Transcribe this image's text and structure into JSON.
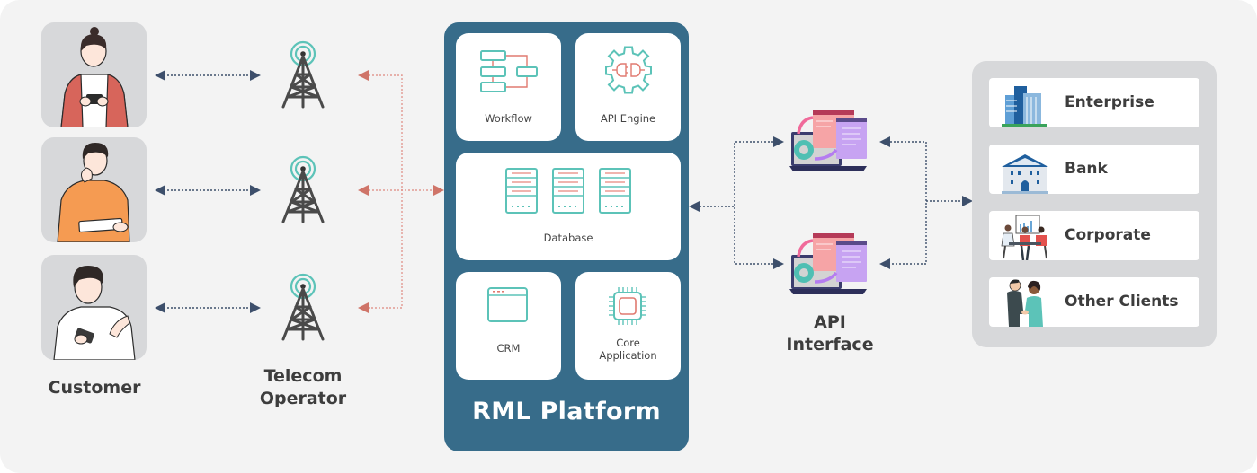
{
  "diagram": {
    "customer_section": {
      "label": "Customer",
      "items": [
        {
          "name": "customer-woman-phone",
          "description": "woman using phone"
        },
        {
          "name": "customer-man-tablet",
          "description": "man with tablet"
        },
        {
          "name": "customer-man-phone",
          "description": "man using phone"
        }
      ]
    },
    "telecom_section": {
      "label_line1": "Telecom",
      "label_line2": "Operator",
      "icon": "cell-tower-icon",
      "count": 3
    },
    "platform": {
      "title": "RML Platform",
      "modules": [
        {
          "id": "workflow",
          "label": "Workflow",
          "icon": "workflow-icon"
        },
        {
          "id": "api-engine",
          "label": "API Engine",
          "icon": "gear-plug-icon"
        },
        {
          "id": "database",
          "label": "Database",
          "icon": "server-icon"
        },
        {
          "id": "crm",
          "label": "CRM",
          "icon": "browser-window-icon"
        },
        {
          "id": "core-application",
          "label_line1": "Core",
          "label_line2": "Application",
          "icon": "chip-icon"
        }
      ]
    },
    "api_interface": {
      "label_line1": "API",
      "label_line2": "Interface",
      "icon": "api-laptop-icon",
      "count": 2
    },
    "clients": {
      "items": [
        {
          "label": "Enterprise",
          "icon": "office-building-icon"
        },
        {
          "label": "Bank",
          "icon": "bank-icon"
        },
        {
          "label": "Corporate",
          "icon": "meeting-icon"
        },
        {
          "label": "Other Clients",
          "icon": "handshake-icon"
        }
      ]
    },
    "colors": {
      "background": "#f3f3f3",
      "platform": "#376c8a",
      "customer_arrow": "#3d4f6b",
      "telecom_arrow": "#cf7468",
      "teal_accent": "#5cc3b8",
      "red_accent": "#e07a70",
      "panel_gray": "#d7d8da"
    }
  }
}
